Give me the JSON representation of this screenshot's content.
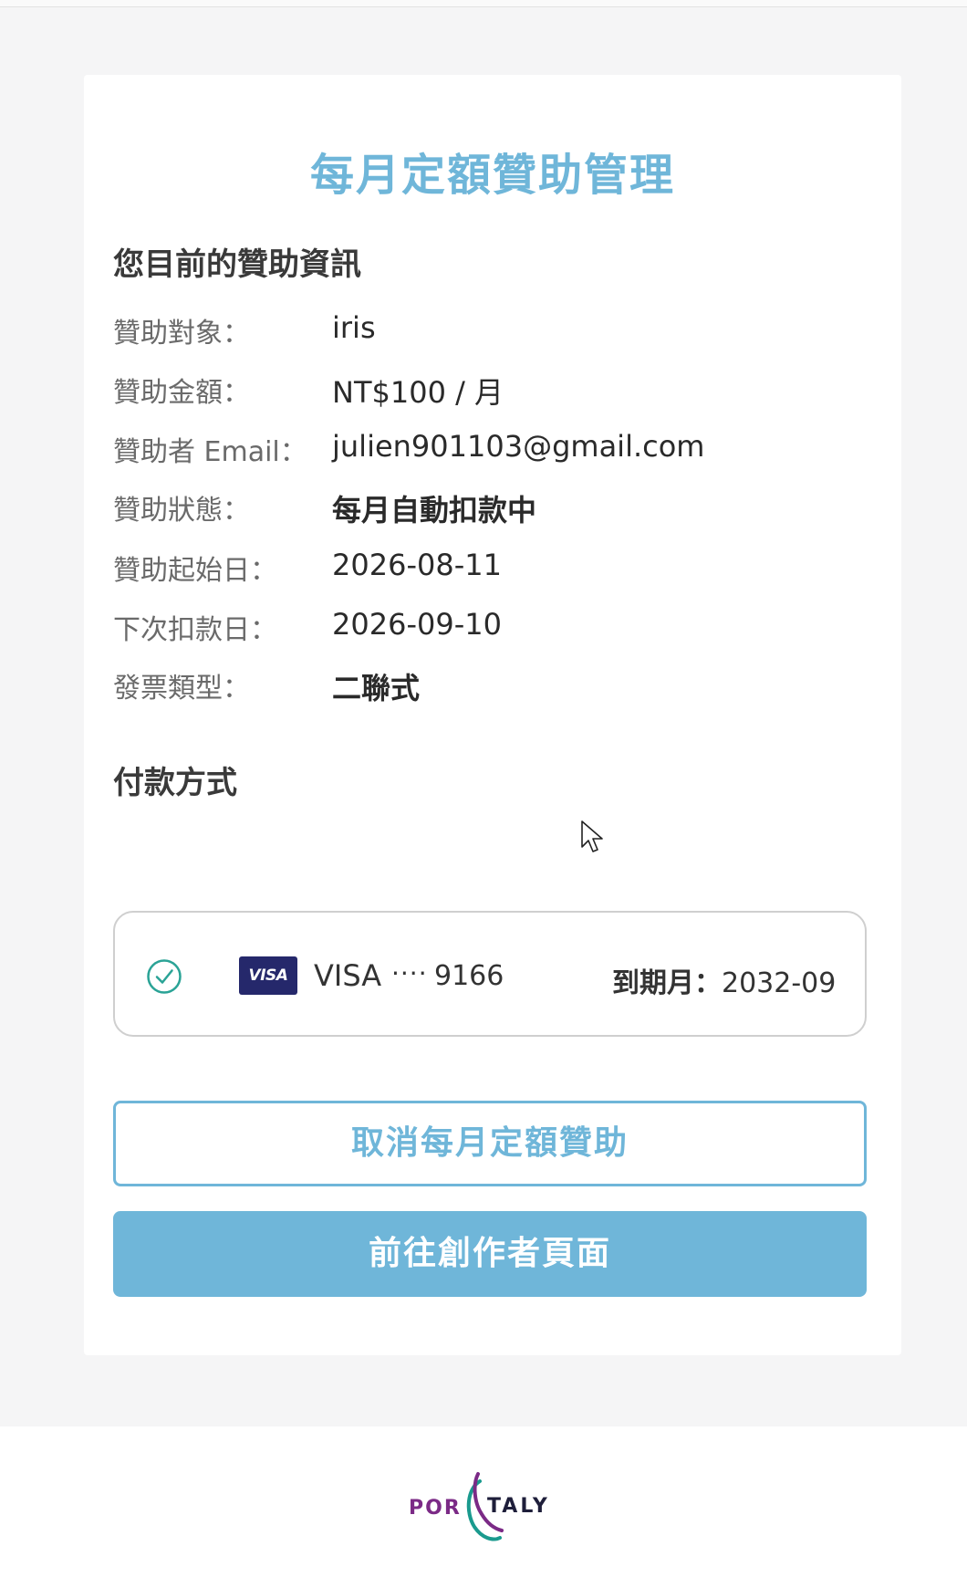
{
  "page": {
    "title": "每月定額贊助管理"
  },
  "sponsorship_info": {
    "heading": "您目前的贊助資訊",
    "rows": [
      {
        "label": "贊助對象：",
        "value": "iris"
      },
      {
        "label": "贊助金額：",
        "value": "NT$100 / 月"
      },
      {
        "label": "贊助者 Email：",
        "value": "julien901103@gmail.com"
      },
      {
        "label": "贊助狀態：",
        "value": "每月自動扣款中"
      },
      {
        "label": "贊助起始日：",
        "value": "2026-08-11"
      },
      {
        "label": "下次扣款日：",
        "value": "2026-09-10"
      },
      {
        "label": "發票類型：",
        "value": "二聯式"
      }
    ]
  },
  "payment": {
    "heading": "付款方式",
    "card_badge": "VISA",
    "card_brand": "VISA",
    "card_dots": "····",
    "card_last4": "9166",
    "expiry_label": "到期月：",
    "expiry_value": "2032-09",
    "selected": true
  },
  "actions": {
    "cancel_label": "取消每月定額贊助",
    "goto_creator_label": "前往創作者頁面"
  },
  "footer": {
    "logo_left": "POR",
    "logo_right": "TALY"
  },
  "colors": {
    "accent": "#6fb6d9",
    "check": "#2aa396",
    "visa_badge": "#25286b",
    "logo_purple": "#7b2a86",
    "logo_teal": "#1a9a8e"
  }
}
